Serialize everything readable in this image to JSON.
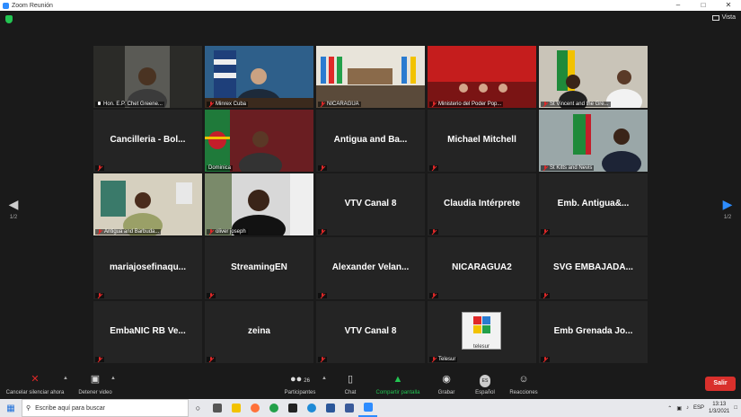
{
  "window": {
    "title": "Zoom Reunión",
    "view_label": "Vista"
  },
  "pager": {
    "left": "1/2",
    "right": "1/2"
  },
  "tiles": [
    {
      "label": "Hon. E.P. Chet Greene...",
      "kind": "video",
      "active": true
    },
    {
      "label": "Minrex Cuba",
      "kind": "video"
    },
    {
      "label": "NICARAGUA",
      "kind": "video"
    },
    {
      "label": "Ministerio del Poder Pop...",
      "kind": "video"
    },
    {
      "label": "St Vincent and the Gre...",
      "kind": "video"
    },
    {
      "big": "Cancilleria - Bol...",
      "kind": "name"
    },
    {
      "label": "Dominica",
      "kind": "video"
    },
    {
      "big": "Antigua and Ba...",
      "kind": "name"
    },
    {
      "big": "Michael Mitchell",
      "kind": "name"
    },
    {
      "label": "St Kitts and Nevis",
      "kind": "video"
    },
    {
      "label": "Antigua and Barbuda...",
      "kind": "video"
    },
    {
      "label": "oliver joseph",
      "kind": "video"
    },
    {
      "big": "VTV Canal 8",
      "kind": "name"
    },
    {
      "big": "Claudia Intérprete",
      "kind": "name"
    },
    {
      "big": "Emb. Antigua&...",
      "kind": "name"
    },
    {
      "big": "mariajosefinaqu...",
      "kind": "name"
    },
    {
      "big": "StreamingEN",
      "kind": "name"
    },
    {
      "big": "Alexander Velan...",
      "kind": "name"
    },
    {
      "big": "NICARAGUA2",
      "kind": "name"
    },
    {
      "big": "SVG EMBAJADA...",
      "kind": "name"
    },
    {
      "big": "EmbaNIC RB Ve...",
      "kind": "name"
    },
    {
      "big": "zeina",
      "kind": "name"
    },
    {
      "big": "VTV Canal 8",
      "kind": "name"
    },
    {
      "label": "Telesur",
      "kind": "logo",
      "logo_text": "telesur"
    },
    {
      "big": "Emb Grenada Jo...",
      "kind": "name"
    }
  ],
  "toolbar": {
    "mute": "Cancelar silenciar ahora",
    "video": "Detener video",
    "participants": "Participantes",
    "participants_count": "26",
    "chat": "Chat",
    "share": "Compartir pantalla",
    "record": "Grabar",
    "language": "Español",
    "language_badge": "ES",
    "reactions": "Reacciones",
    "leave": "Salir"
  },
  "taskbar": {
    "search_placeholder": "Escribe aquí para buscar",
    "lang": "ESP",
    "time": "13:13",
    "date": "1/3/2021"
  },
  "colors": {
    "accent_green": "#23c552",
    "leave_red": "#d9302c",
    "active_outline": "#e6e07a",
    "zoom_blue": "#2d8cff"
  }
}
